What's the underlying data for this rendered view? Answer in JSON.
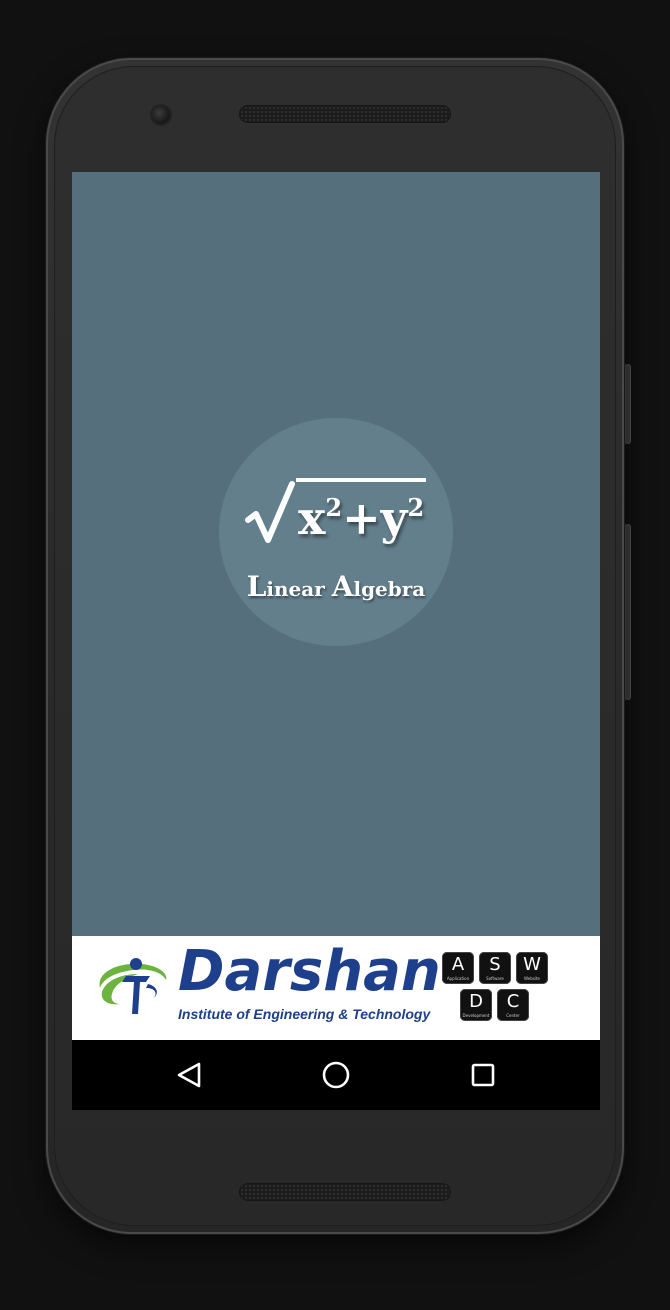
{
  "splash": {
    "logo": {
      "formula_base_1": "x",
      "formula_exp_1": "2",
      "formula_plus": "+",
      "formula_base_2": "y",
      "formula_exp_2": "2",
      "name_cap_1": "L",
      "name_rest_1": "inear",
      "name_cap_2": "A",
      "name_rest_2": "lgebra"
    }
  },
  "banner": {
    "institute_name": "Darshan",
    "institute_tagline": "Institute of Engineering & Technology",
    "aswdc_keys": [
      {
        "key": "A",
        "sub": "Application"
      },
      {
        "key": "S",
        "sub": "Software"
      },
      {
        "key": "W",
        "sub": "Website"
      },
      {
        "key": "D",
        "sub": "Development"
      },
      {
        "key": "C",
        "sub": "Center"
      }
    ]
  },
  "navbar": {
    "icons": [
      "back-triangle-icon",
      "home-circle-icon",
      "recents-square-icon"
    ]
  },
  "colors": {
    "screen_background": "#566f7c",
    "logo_circle": "#637f8c",
    "institute_blue": "#1e3f8c",
    "institute_green": "#6cb33f",
    "navbar": "#000000"
  }
}
